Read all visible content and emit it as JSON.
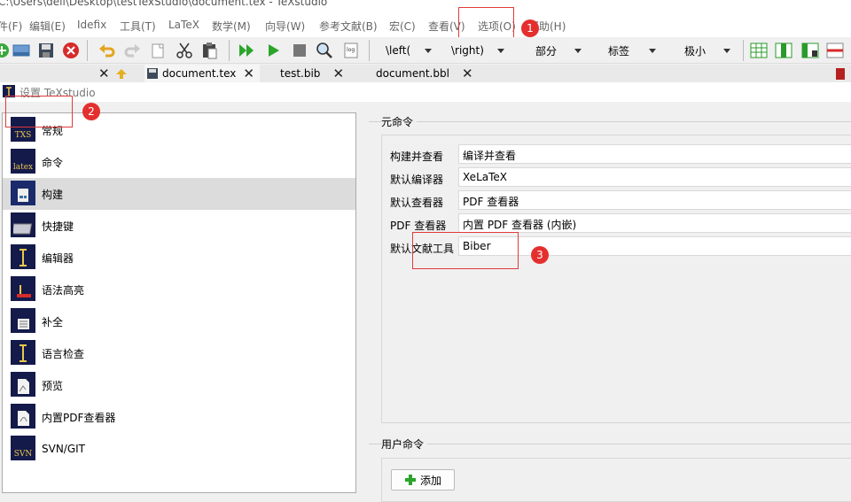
{
  "window": {
    "title": "C:\\Users\\dell\\Desktop\\testTexStudio\\document.tex - TeXstudio"
  },
  "menu": [
    "件(F)",
    "编辑(E)",
    "Idefix",
    "工具(T)",
    "LaTeX",
    "数学(M)",
    "向导(W)",
    "参考文献(B)",
    "宏(C)",
    "查看(V)",
    "选项(O)",
    "帮助(H)"
  ],
  "toolbar": {
    "icons": [
      "new-file-icon",
      "open-icon",
      "save-icon",
      "close-doc-icon",
      "undo-icon",
      "redo-icon",
      "copy-icon",
      "cut-icon",
      "paste-icon",
      "build-view-icon",
      "compile-icon",
      "stop-icon",
      "view-icon",
      "log-icon"
    ],
    "combos": [
      "\\left(",
      "\\right)",
      "部分",
      "标签",
      "极小"
    ]
  },
  "tabs": [
    "document.tex",
    "test.bib",
    "document.bbl"
  ],
  "dialog": {
    "title": "设置 TeXstudio",
    "categories": [
      "常规",
      "命令",
      "构建",
      "快捷键",
      "编辑器",
      "语法高亮",
      "补全",
      "语言检查",
      "预览",
      "内置PDF查看器",
      "SVN/GIT"
    ],
    "category_icon_text": [
      "TXS",
      "latex",
      "",
      "",
      "",
      "",
      "",
      "",
      "",
      "",
      "SVN"
    ],
    "selected_category": "构建",
    "meta_group_title": "元命令",
    "rows": [
      {
        "label": "构建并查看",
        "value": "编译并查看"
      },
      {
        "label": "默认编译器",
        "value": "XeLaTeX"
      },
      {
        "label": "默认查看器",
        "value": "PDF 查看器"
      },
      {
        "label": "PDF 查看器",
        "value": "内置 PDF 查看器 (内嵌)"
      },
      {
        "label": "默认文献工具",
        "value": "Biber"
      }
    ],
    "user_group_title": "用户命令",
    "add_button": "添加"
  },
  "annotations": [
    "1",
    "2",
    "3"
  ],
  "colors": {
    "annotation": "#e03a3a",
    "selected_row": "#dcdcdc",
    "icon_bg": "#141a4a"
  }
}
